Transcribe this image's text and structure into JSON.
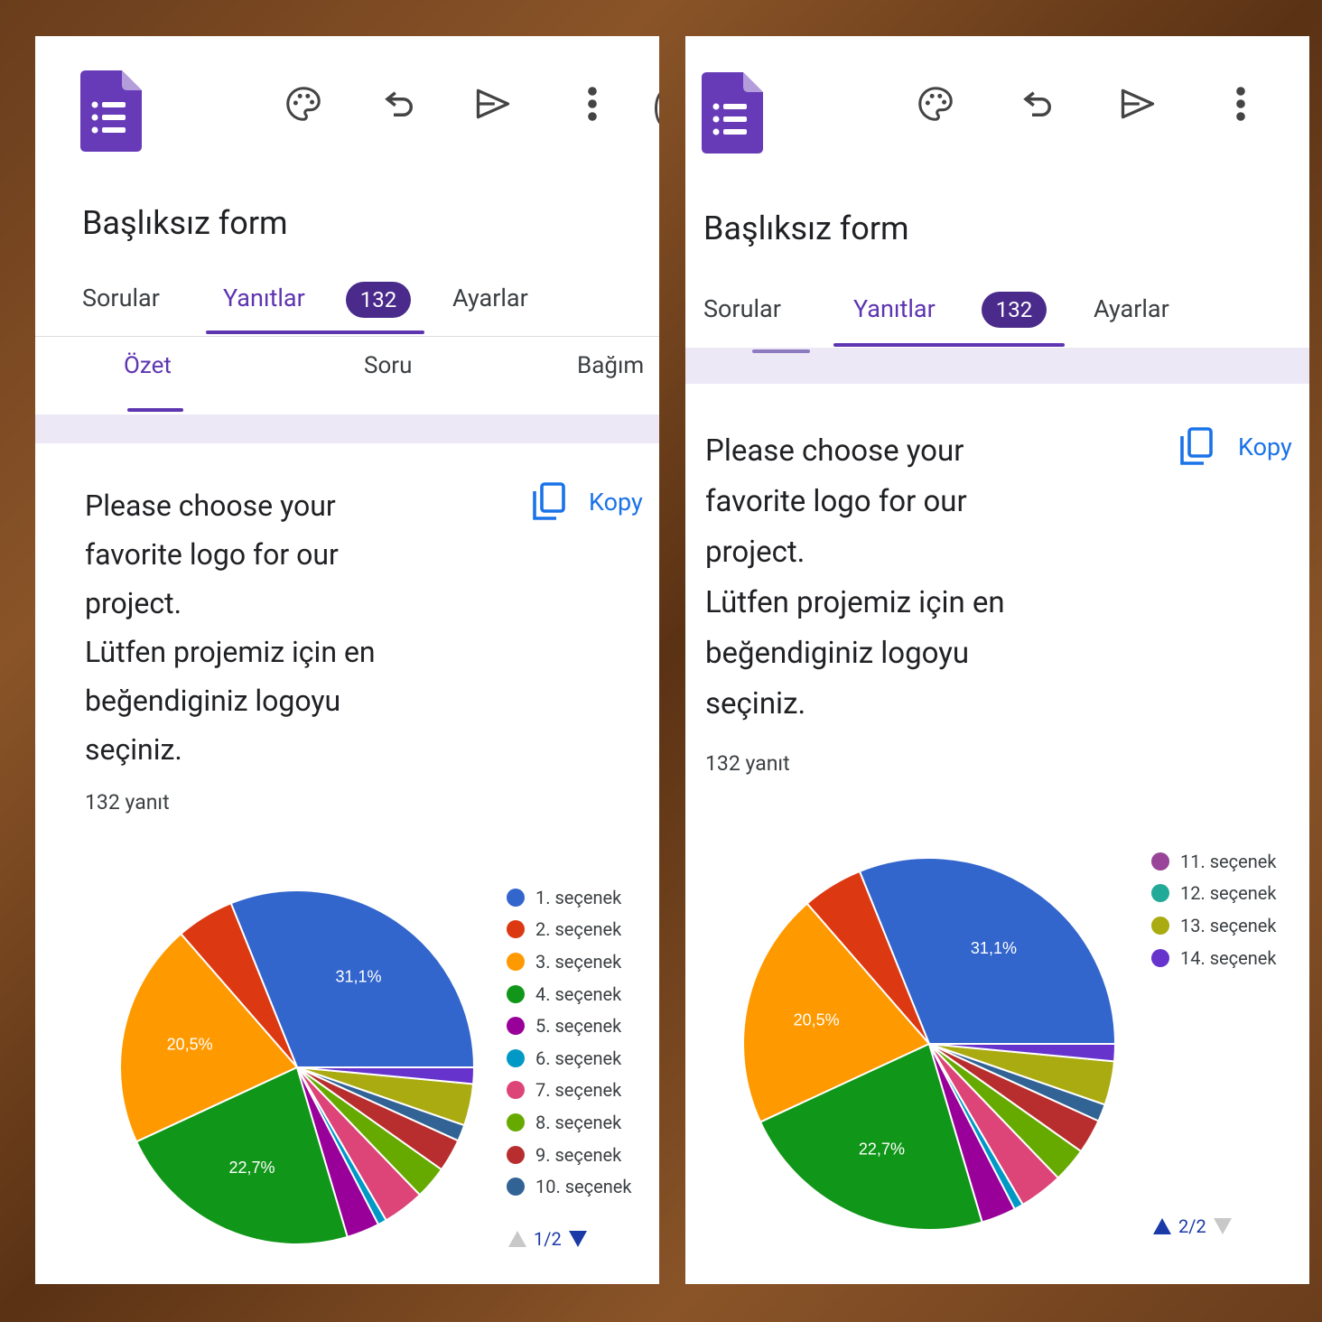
{
  "app": {
    "form_title": "Başlıksız form",
    "tabs": {
      "questions": "Sorular",
      "responses": "Yanıtlar",
      "responses_count": "132",
      "settings": "Ayarlar"
    },
    "subtabs": {
      "summary": "Özet",
      "question": "Soru",
      "individual": "Bağım"
    },
    "copy_label": "Kopy",
    "icons": [
      "forms-logo-icon",
      "palette-icon",
      "undo-icon",
      "send-icon",
      "more-vert-icon",
      "copy-icon"
    ]
  },
  "question": {
    "text": "Please choose your\nfavorite logo for our\nproject.\nLütfen projemiz için en\nbeğendiginiz logoyu\nseçiniz.",
    "response_count": "132 yanıt"
  },
  "chart_data": {
    "type": "pie",
    "labels": [
      "1. seçenek",
      "2. seçenek",
      "3. seçenek",
      "4. seçenek",
      "5. seçenek",
      "6. seçenek",
      "7. seçenek",
      "8. seçenek",
      "9. seçenek",
      "10. seçenek",
      "11. seçenek",
      "12. seçenek",
      "13. seçenek",
      "14. seçenek"
    ],
    "values": [
      31.1,
      5.3,
      20.5,
      22.7,
      3.0,
      0.8,
      3.8,
      3.0,
      3.0,
      1.5,
      0,
      0,
      3.8,
      1.5
    ],
    "colors": [
      "#3366cc",
      "#dc3912",
      "#ff9900",
      "#109618",
      "#990099",
      "#0099c6",
      "#dd4477",
      "#66aa00",
      "#b82e2e",
      "#316395",
      "#994499",
      "#22aa99",
      "#aaaa11",
      "#6633cc"
    ],
    "slice_labels": [
      "31,1%",
      "",
      "20,5%",
      "22,7%",
      "",
      "",
      "",
      "",
      "",
      "",
      "",
      "",
      "",
      ""
    ],
    "legend_pages": [
      [
        0,
        1,
        2,
        3,
        4,
        5,
        6,
        7,
        8,
        9
      ],
      [
        10,
        11,
        12,
        13
      ]
    ],
    "pagers": [
      "1/2",
      "2/2"
    ]
  }
}
